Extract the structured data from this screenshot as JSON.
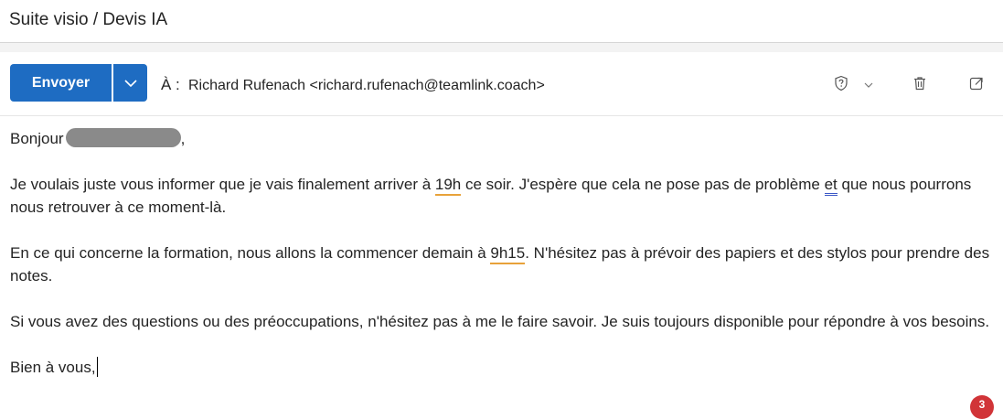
{
  "subject": "Suite visio / Devis IA",
  "toolbar": {
    "send_label": "Envoyer",
    "to_label": "À :",
    "recipient": "Richard Rufenach <richard.rufenach@teamlink.coach>"
  },
  "body": {
    "greeting_start": "Bonjour",
    "greeting_end": ",",
    "p1_part1": "Je voulais juste vous informer que je vais finalement arriver à ",
    "p1_time": "19h",
    "p1_part2": " ce soir. J'espère que cela ne pose pas de problème ",
    "p1_et": "et",
    "p1_part3": " que nous pourrons nous retrouver à ce moment-là.",
    "p2_part1": "En ce qui concerne la formation, nous allons la commencer demain à ",
    "p2_time": "9h15",
    "p2_part2": ". N'hésitez pas à prévoir des papiers et des stylos pour prendre des notes.",
    "p3": "Si vous avez des questions ou des préoccupations, n'hésitez pas à me le faire savoir. Je suis toujours disponible pour répondre à vos besoins.",
    "closing": "Bien à vous,"
  },
  "notification_count": "3",
  "colors": {
    "accent": "#1e6cc2",
    "spell_orange": "#e8a23a",
    "grammar_blue": "#3b57c6",
    "badge_red": "#d13438"
  },
  "icons": {
    "send_dropdown": "chevron-down-icon",
    "sensitivity": "shield-question-icon",
    "sensitivity_dropdown": "chevron-down-icon",
    "discard": "trash-icon",
    "popout": "popout-icon"
  }
}
